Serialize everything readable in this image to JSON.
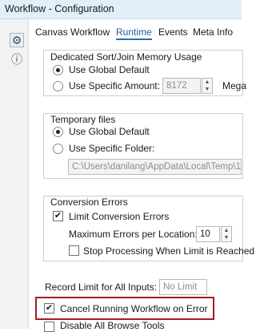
{
  "window": {
    "title": "Workflow - Configuration"
  },
  "sidebar": {
    "icons": [
      "gear-icon",
      "help-icon"
    ]
  },
  "tabs": [
    {
      "label": "Canvas",
      "active": false
    },
    {
      "label": "Workflow",
      "active": false
    },
    {
      "label": "Runtime",
      "active": true
    },
    {
      "label": "Events",
      "active": false
    },
    {
      "label": "Meta Info",
      "active": false
    }
  ],
  "dedicated_sort": {
    "title": "Dedicated Sort/Join Memory Usage",
    "option_global": "Use Global Default",
    "option_specific": "Use Specific Amount:",
    "amount_value": "8172",
    "unit_label": "Mega",
    "selected": "global"
  },
  "temporary_files": {
    "title": "Temporary files",
    "option_global": "Use Global Default",
    "option_folder": "Use Specific Folder:",
    "folder_path": "C:\\Users\\danilang\\AppData\\Local\\Temp\\1\\",
    "selected": "global"
  },
  "conversion_errors": {
    "title": "Conversion Errors",
    "limit_label": "Limit Conversion Errors",
    "limit_checked": true,
    "max_errors_label": "Maximum Errors per Location:",
    "max_errors_value": "10",
    "stop_label": "Stop Processing When Limit is Reached",
    "stop_checked": false
  },
  "record_limit": {
    "label": "Record Limit for All Inputs:",
    "placeholder": "No Limit"
  },
  "cancel_on_error": {
    "label": "Cancel Running Workflow on Error",
    "checked": true,
    "highlight_color": "#a31d24"
  },
  "disable_browse": {
    "label": "Disable All Browse Tools",
    "checked": false
  }
}
